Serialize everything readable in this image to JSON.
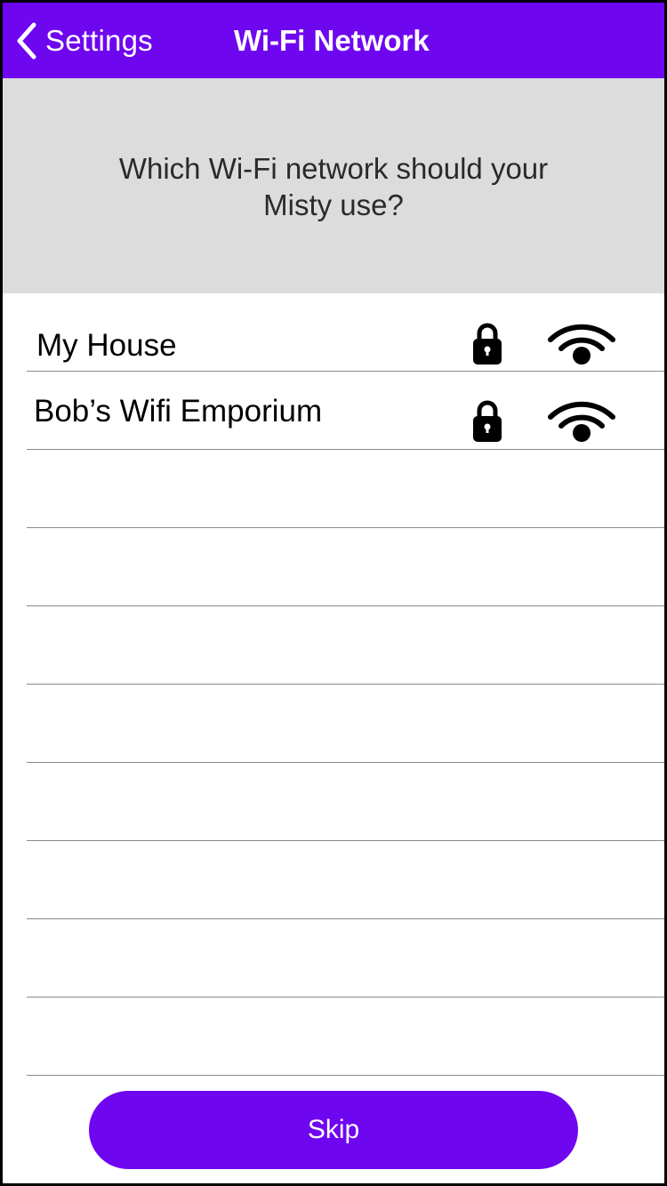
{
  "navbar": {
    "back_label": "Settings",
    "title": "Wi-Fi Network",
    "back_icon": "chevron-left-icon"
  },
  "prompt": {
    "line1": "Which Wi-Fi network should your",
    "line2": "Misty use?"
  },
  "networks": [
    {
      "name": "My House",
      "secured_icon": "lock-icon",
      "signal_icon": "wifi-signal-icon"
    },
    {
      "name": "Bob’s Wifi Emporium",
      "secured_icon": "lock-icon",
      "signal_icon": "wifi-signal-icon"
    }
  ],
  "skip_label": "Skip",
  "colors": {
    "accent": "#6f06f0",
    "prompt_background": "#dcdcdc",
    "separator": "#8a8a8a"
  }
}
